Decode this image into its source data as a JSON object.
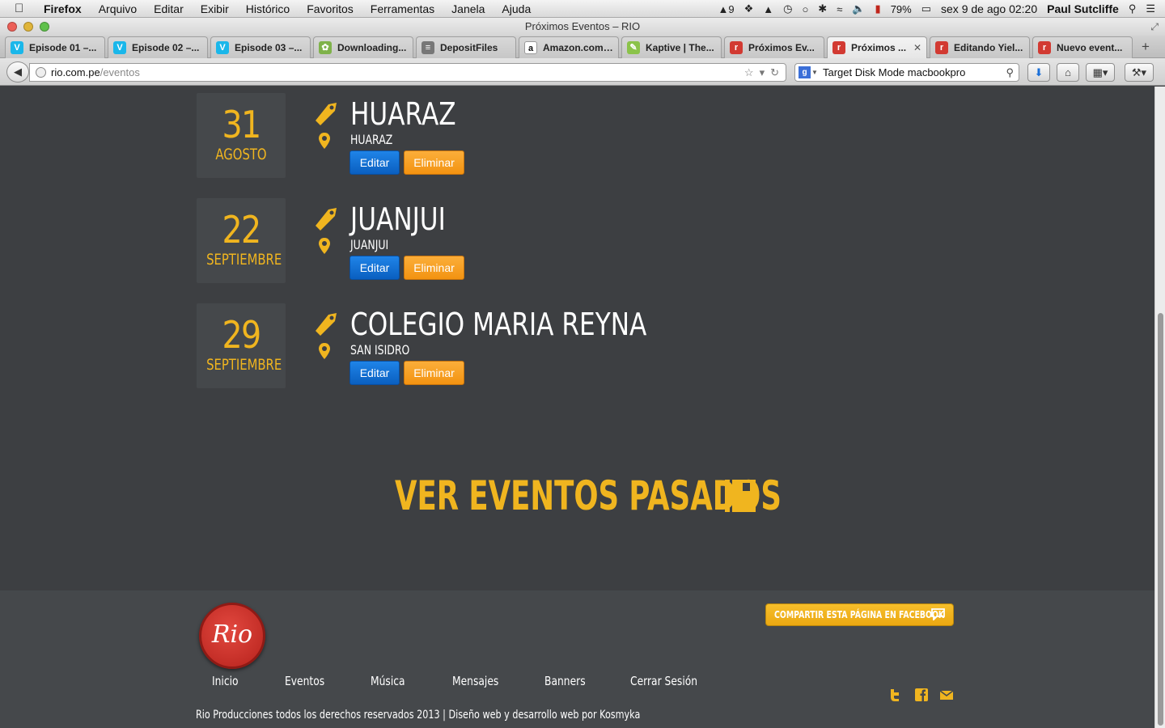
{
  "menubar": {
    "app_name": "Firefox",
    "items": [
      "Arquivo",
      "Editar",
      "Exibir",
      "Histórico",
      "Favoritos",
      "Ferramentas",
      "Janela",
      "Ajuda"
    ],
    "status": {
      "adobe_count": "9",
      "battery": "79%",
      "datetime": "sex 9 de ago  02:20",
      "user": "Paul Sutcliffe"
    }
  },
  "window": {
    "title": "Próximos Eventos – RIO"
  },
  "tabs": [
    {
      "label": "Episode 01 –...",
      "icon": "vimeo-icon",
      "color": "#1ab7ea",
      "glyph": "V"
    },
    {
      "label": "Episode 02 –...",
      "icon": "vimeo-icon",
      "color": "#1ab7ea",
      "glyph": "V"
    },
    {
      "label": "Episode 03 –...",
      "icon": "vimeo-icon",
      "color": "#1ab7ea",
      "glyph": "V"
    },
    {
      "label": "Downloading...",
      "icon": "download-icon",
      "color": "#7fb24a",
      "glyph": "✿"
    },
    {
      "label": "DepositFiles",
      "icon": "depositfiles-icon",
      "color": "#777777",
      "glyph": "≡"
    },
    {
      "label": "Amazon.com:...",
      "icon": "amazon-icon",
      "color": "#ffffff",
      "glyph": "a"
    },
    {
      "label": "Kaptive | The...",
      "icon": "kaptive-icon",
      "color": "#8bc34a",
      "glyph": "✎"
    },
    {
      "label": "Próximos Ev...",
      "icon": "rio-icon",
      "color": "#d23a32",
      "glyph": "r"
    },
    {
      "label": "Próximos ...",
      "icon": "rio-icon",
      "color": "#d23a32",
      "glyph": "r",
      "active": true,
      "close": "✕"
    },
    {
      "label": "Editando Yiel...",
      "icon": "rio-icon",
      "color": "#d23a32",
      "glyph": "r"
    },
    {
      "label": "Nuevo event...",
      "icon": "rio-icon",
      "color": "#d23a32",
      "glyph": "r"
    }
  ],
  "newtab": "+",
  "navbar": {
    "url_host": "rio.com.pe",
    "url_path": "/eventos",
    "search_value": "Target Disk Mode macbookpro",
    "search_engine": "g"
  },
  "events": [
    {
      "day": "31",
      "month": "AGOSTO",
      "title": "HUARAZ",
      "place": "HUARAZ",
      "edit_label": "Editar",
      "delete_label": "Eliminar"
    },
    {
      "day": "22",
      "month": "SEPTIEMBRE",
      "title": "JUANJUI",
      "place": "JUANJUI",
      "edit_label": "Editar",
      "delete_label": "Eliminar"
    },
    {
      "day": "29",
      "month": "SEPTIEMBRE",
      "title": "COLEGIO MARIA REYNA",
      "place": "SAN ISIDRO",
      "edit_label": "Editar",
      "delete_label": "Eliminar"
    }
  ],
  "past_events": {
    "label": "VER EVENTOS PASADOS"
  },
  "footer": {
    "logo_text": "Rio",
    "share_label": "COMPARTIR ESTA PÁGINA EN FACEBOOK",
    "nav": [
      "Inicio",
      "Eventos",
      "Música",
      "Mensajes",
      "Banners",
      "Cerrar Sesión"
    ],
    "copyright": "Rio Producciones todos los derechos reservados 2013 | Diseño web y desarrollo web por Kosmyka",
    "social": [
      "twitter-icon",
      "facebook-icon",
      "email-icon"
    ]
  },
  "colors": {
    "accent": "#f0b51f",
    "page_bg": "#3d3f42",
    "footer_bg": "#45484b",
    "edit_button": "#0a6ad0",
    "delete_button": "#f7a020"
  }
}
